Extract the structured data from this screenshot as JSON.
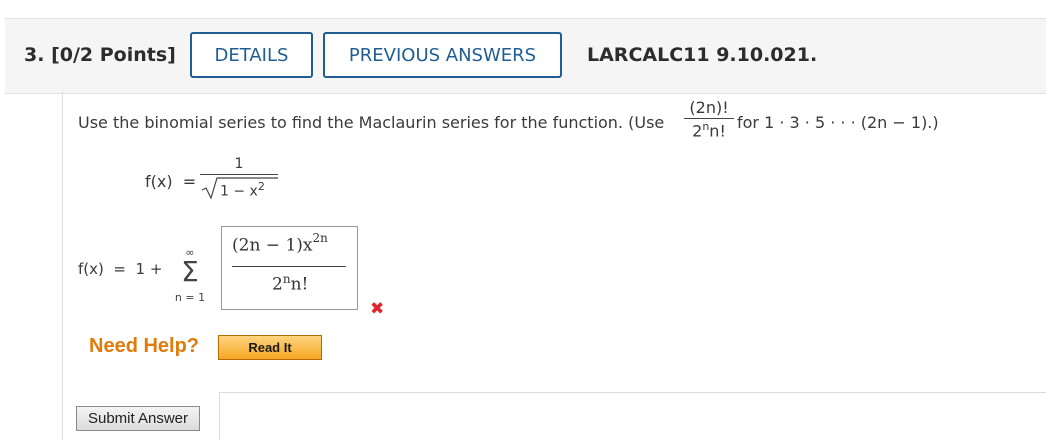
{
  "question": {
    "number_label": "3.",
    "points_label": "[0/2 Points]",
    "details_button": "DETAILS",
    "previous_answers_button": "PREVIOUS ANSWERS",
    "reference": "LARCALC11 9.10.021."
  },
  "prompt": {
    "text_before": "Use the binomial series to find the Maclaurin series for the function. (Use",
    "hint_numerator": "(2n)!",
    "hint_den_base": "2",
    "hint_den_exp": "n",
    "hint_den_rest": "n!",
    "text_after": "for 1 · 3 · 5 · · · (2n − 1).)"
  },
  "function": {
    "lhs": "f(x)",
    "equals": "=",
    "numerator": "1",
    "radicand": "1 − x",
    "radicand_exp": "2"
  },
  "series": {
    "lhs": "f(x)",
    "equals": "=",
    "prefix": "1 +",
    "sum_upper": "∞",
    "sum_symbol": "Σ",
    "sum_lower": "n = 1"
  },
  "answer": {
    "numerator_text": "(2n − 1)x",
    "numerator_exp": "2n",
    "denominator_base": "2",
    "denominator_exp": "n",
    "denominator_rest": "n!",
    "status": "incorrect",
    "status_icon": "red-x-icon",
    "status_glyph": "✖"
  },
  "help": {
    "label": "Need Help?",
    "read_it_button": "Read It"
  },
  "submit_button": "Submit Answer",
  "colors": {
    "accent_blue": "#1f5d93",
    "help_orange": "#e07b0c",
    "error_red": "#e0262b"
  }
}
